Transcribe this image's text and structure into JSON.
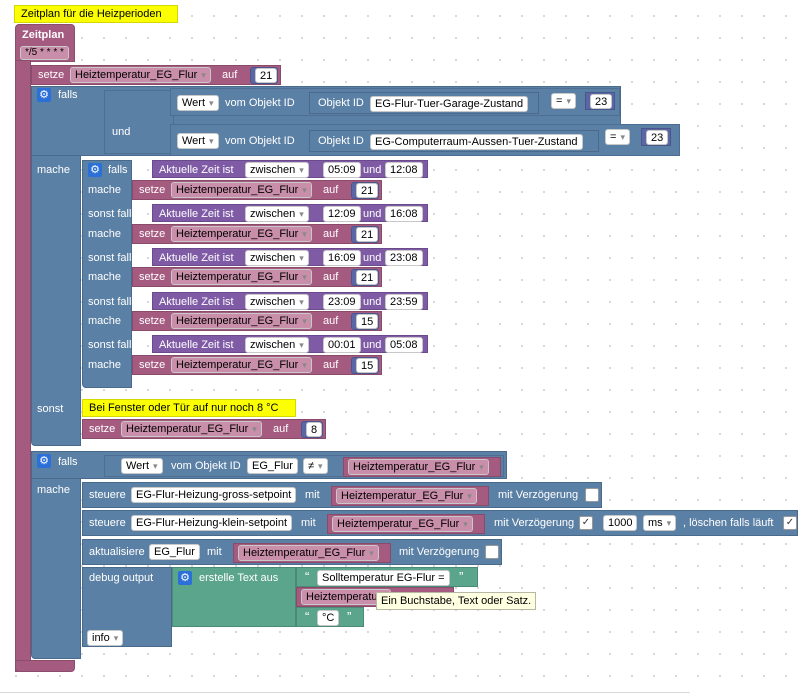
{
  "comment_top": "Zeitplan für die Heizperioden",
  "schedule": {
    "label": "Zeitplan",
    "cron": "*/5 * * * *"
  },
  "set": {
    "label": "setze",
    "to": "auf"
  },
  "var_name": "Heiztemperatur_EG_Flur",
  "values": {
    "v21": "21",
    "v15": "15",
    "v8": "8",
    "v23": "23",
    "v1000": "1000"
  },
  "if": {
    "falls": "falls",
    "und": "und",
    "mache": "mache",
    "sonst_falls": "sonst falls",
    "sonst": "sonst"
  },
  "cond": {
    "wert": "Wert",
    "vom_objekt": "vom Objekt ID",
    "objekt_id": "Objekt ID",
    "obj1": "EG-Flur-Tuer-Garage-Zustand",
    "obj2": "EG-Computerraum-Aussen-Tuer-Zustand",
    "eq": "=",
    "neq": "≠",
    "obj_flur": "EG_Flur"
  },
  "time": {
    "label": "Aktuelle Zeit ist",
    "between": "zwischen",
    "und": "und"
  },
  "ranges": [
    {
      "from": "05:09",
      "to": "12:08",
      "value": "21"
    },
    {
      "from": "12:09",
      "to": "16:08",
      "value": "21"
    },
    {
      "from": "16:09",
      "to": "23:08",
      "value": "21"
    },
    {
      "from": "23:09",
      "to": "23:59",
      "value": "15"
    },
    {
      "from": "00:01",
      "to": "05:08",
      "value": "15"
    }
  ],
  "comment_else": "Bei Fenster oder Tür auf nur noch 8 °C",
  "control": {
    "steuere": "steuere",
    "mit": "mit",
    "obj_gross": "EG-Flur-Heizung-gross-setpoint",
    "obj_klein": "EG-Flur-Heizung-klein-setpoint",
    "delay": "mit Verzögerung",
    "unit": "ms",
    "clear": ", löschen falls läuft",
    "check_mark": "✓"
  },
  "update": {
    "label": "aktualisiere",
    "obj": "EG_Flur",
    "mit": "mit"
  },
  "debug": {
    "label": "debug output",
    "create_text": "erstelle Text aus",
    "text1": "Solltemperatur EG-Flur =",
    "var_short": "Heiztemperatu",
    "text2": "°C",
    "level": "info"
  },
  "quote_open": "“",
  "quote_close": "”",
  "tooltip": "Ein Buchstabe, Text oder Satz."
}
